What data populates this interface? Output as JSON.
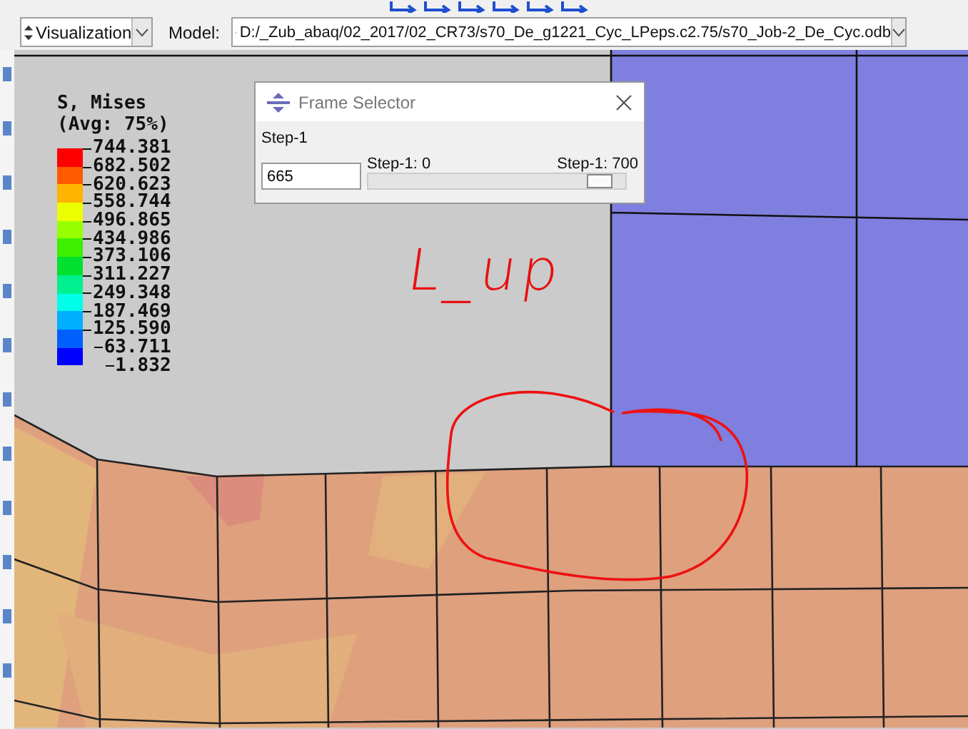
{
  "context_bar": {
    "module": {
      "value": "Visualization"
    },
    "model": {
      "label": "Model:",
      "value": "D:/_Zub_abaq/02_2017/02_CR73/s70_De_g1221_Cyc_LPeps.c2.75/s70_Job-2_De_Cyc.odb"
    }
  },
  "legend": {
    "title": "S, Mises",
    "subtitle": "(Avg: 75%)",
    "levels": [
      {
        "color": "#ff0000"
      },
      {
        "color": "#ff5a00"
      },
      {
        "color": "#ffb400"
      },
      {
        "color": "#ecff00"
      },
      {
        "color": "#98ff00"
      },
      {
        "color": "#3cf000"
      },
      {
        "color": "#00e030"
      },
      {
        "color": "#00f090"
      },
      {
        "color": "#00ffe8"
      },
      {
        "color": "#00b0ff"
      },
      {
        "color": "#0060ff"
      },
      {
        "color": "#0000ff"
      }
    ],
    "values": [
      "744.381",
      "682.502",
      "620.623",
      "558.744",
      "496.865",
      "434.986",
      "373.106",
      "311.227",
      "249.348",
      "187.469",
      "125.590",
      "63.711",
      "1.832"
    ]
  },
  "annotation": {
    "text": "L_up"
  },
  "frame_selector": {
    "title": "Frame Selector",
    "step": "Step-1",
    "frame": "665",
    "slider": {
      "min_label": "Step-1: 0",
      "max_label": "Step-1: 700",
      "level": 0.95
    }
  }
}
